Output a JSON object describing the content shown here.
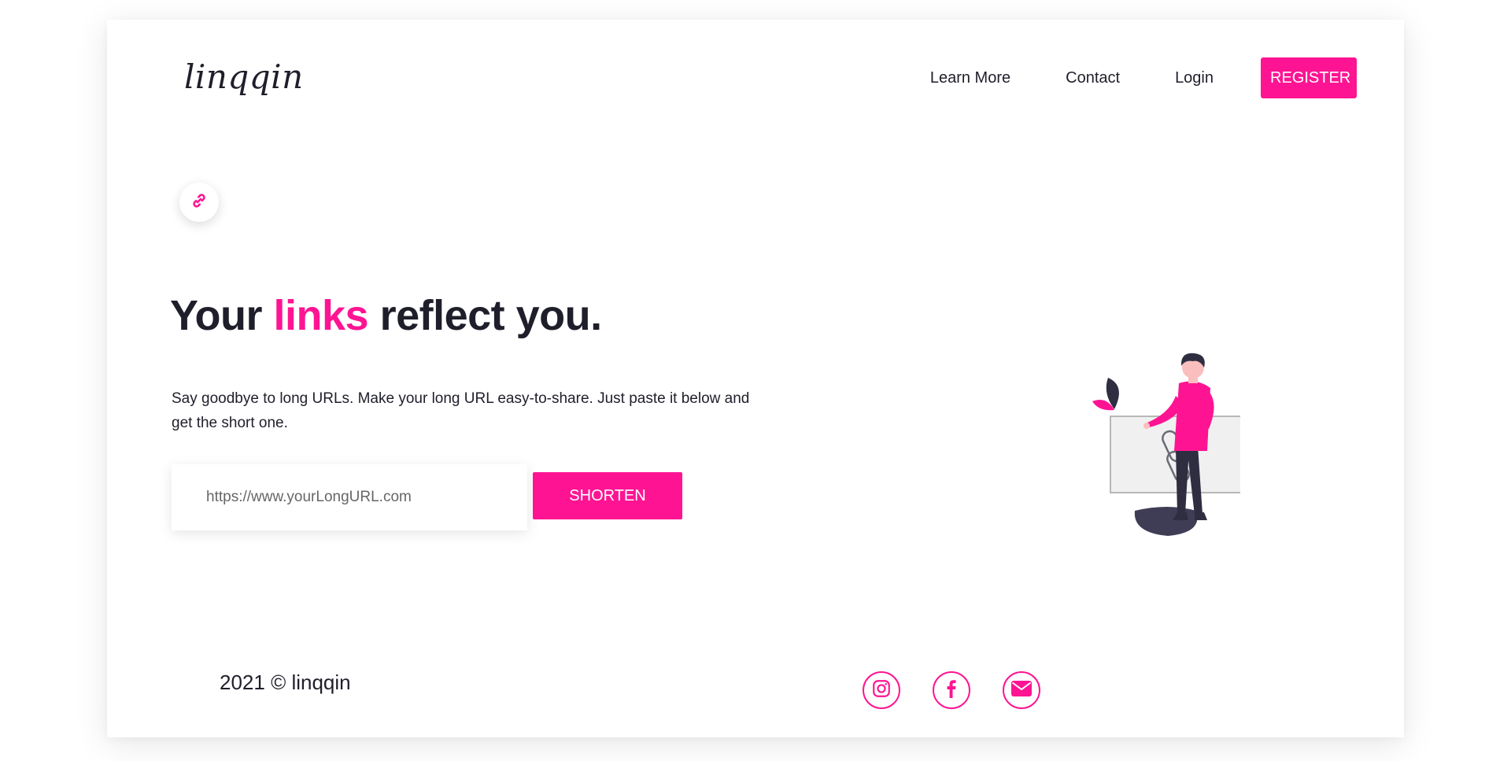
{
  "brand": {
    "logo": "linqqin",
    "accent_color": "#fe1493"
  },
  "nav": {
    "learn_more": "Learn More",
    "contact": "Contact",
    "login": "Login",
    "register": "REGISTER"
  },
  "hero": {
    "title_prefix": "Your ",
    "title_accent": "links",
    "title_suffix": " reflect you.",
    "description": "Say goodbye to long URLs. Make your long URL easy-to-share. Just paste it below and get the short one.",
    "input_placeholder": "https://www.yourLongURL.com",
    "input_value": "",
    "shorten_label": "SHORTEN",
    "badge_icon": "link-icon"
  },
  "illustration": {
    "icon": "chain-link-icon"
  },
  "footer": {
    "copyright": "2021 © linqqin",
    "socials": [
      {
        "icon": "instagram-icon"
      },
      {
        "icon": "facebook-icon"
      },
      {
        "icon": "mail-icon"
      }
    ]
  }
}
